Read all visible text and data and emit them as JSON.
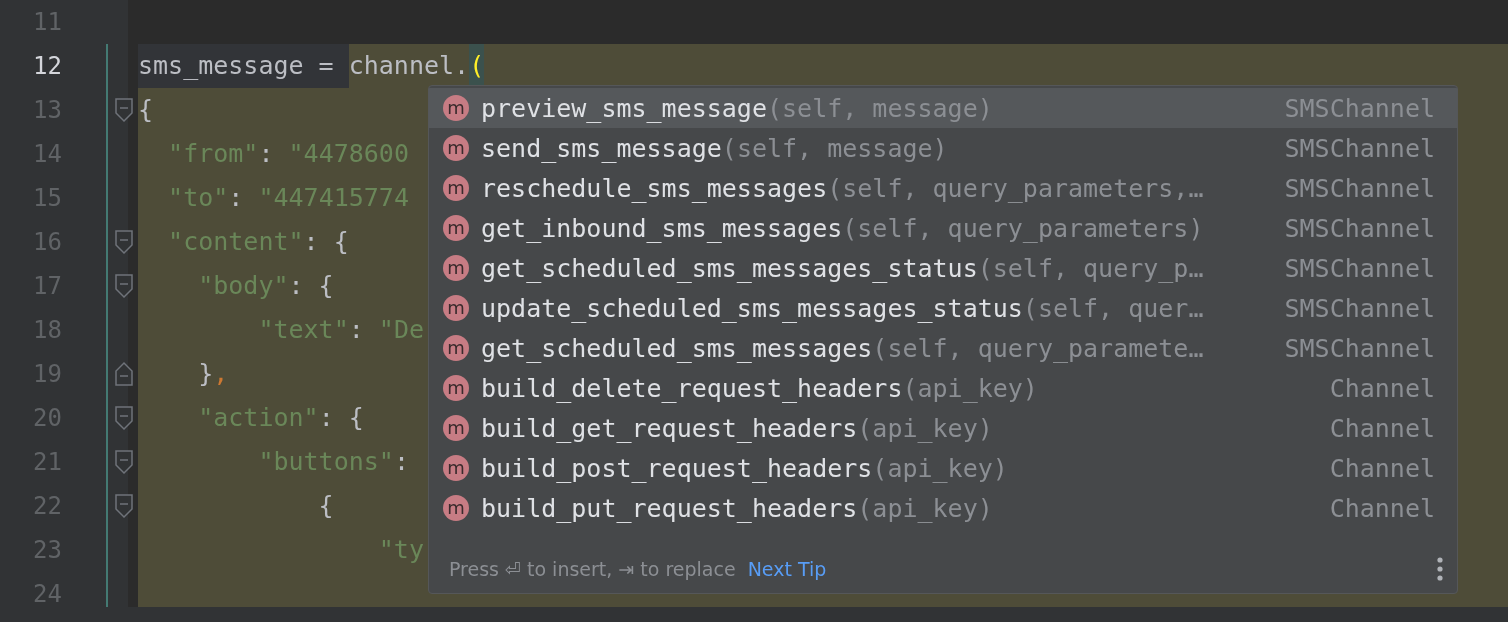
{
  "editor": {
    "lines": [
      {
        "number": "11",
        "current": false,
        "changed": false,
        "injected": false
      },
      {
        "number": "12",
        "current": true,
        "changed": true,
        "injected": false,
        "segments": [
          {
            "kind": "plain",
            "text": "sms_message = ",
            "injected": false
          },
          {
            "kind": "plain",
            "text": "channel.",
            "injected": true
          },
          {
            "kind": "match",
            "text": "(",
            "injected": true
          }
        ]
      },
      {
        "number": "13",
        "current": false,
        "changed": true,
        "injected": true,
        "marker": {
          "kind": "fold-start"
        },
        "segments": [
          {
            "kind": "punct",
            "text": "{"
          }
        ]
      },
      {
        "number": "14",
        "current": false,
        "changed": true,
        "injected": true,
        "segments": [
          {
            "kind": "key",
            "text": "  \"from\""
          },
          {
            "kind": "punct",
            "text": ": "
          },
          {
            "kind": "string",
            "text": "\"4478600"
          }
        ]
      },
      {
        "number": "15",
        "current": false,
        "changed": true,
        "injected": true,
        "segments": [
          {
            "kind": "key",
            "text": "  \"to\""
          },
          {
            "kind": "punct",
            "text": ": "
          },
          {
            "kind": "string",
            "text": "\"447415774"
          }
        ]
      },
      {
        "number": "16",
        "current": false,
        "changed": true,
        "injected": true,
        "marker": {
          "kind": "fold-start"
        },
        "segments": [
          {
            "kind": "key",
            "text": "  \"content\""
          },
          {
            "kind": "punct",
            "text": ": {"
          }
        ]
      },
      {
        "number": "17",
        "current": false,
        "changed": true,
        "injected": true,
        "marker": {
          "kind": "fold-start"
        },
        "segments": [
          {
            "kind": "key",
            "text": "    \"body\""
          },
          {
            "kind": "punct",
            "text": ": {"
          }
        ]
      },
      {
        "number": "18",
        "current": false,
        "changed": true,
        "injected": true,
        "segments": [
          {
            "kind": "key",
            "text": "        \"text\""
          },
          {
            "kind": "punct",
            "text": ": "
          },
          {
            "kind": "string",
            "text": "\"De"
          }
        ]
      },
      {
        "number": "19",
        "current": false,
        "changed": true,
        "injected": true,
        "marker": {
          "kind": "fold-end"
        },
        "segments": [
          {
            "kind": "punct",
            "text": "    }"
          },
          {
            "kind": "comma",
            "text": ","
          }
        ]
      },
      {
        "number": "20",
        "current": false,
        "changed": true,
        "injected": true,
        "marker": {
          "kind": "fold-start"
        },
        "segments": [
          {
            "kind": "key",
            "text": "    \"action\""
          },
          {
            "kind": "punct",
            "text": ": {"
          }
        ]
      },
      {
        "number": "21",
        "current": false,
        "changed": true,
        "injected": true,
        "marker": {
          "kind": "fold-start"
        },
        "segments": [
          {
            "kind": "key",
            "text": "        \"buttons\""
          },
          {
            "kind": "punct",
            "text": ":"
          }
        ]
      },
      {
        "number": "22",
        "current": false,
        "changed": true,
        "injected": true,
        "marker": {
          "kind": "fold-start"
        },
        "segments": [
          {
            "kind": "punct",
            "text": "            {"
          }
        ]
      },
      {
        "number": "23",
        "current": false,
        "changed": true,
        "injected": true,
        "segments": [
          {
            "kind": "key",
            "text": "                \"ty"
          }
        ]
      },
      {
        "number": "24",
        "current": false,
        "changed": true,
        "injected": true
      }
    ]
  },
  "completion": {
    "items": [
      {
        "badge": "m",
        "name": "preview_sms_message",
        "params": "(self, message)",
        "type": "SMSChannel",
        "selected": true
      },
      {
        "badge": "m",
        "name": "send_sms_message",
        "params": "(self, message)",
        "type": "SMSChannel",
        "selected": false
      },
      {
        "badge": "m",
        "name": "reschedule_sms_messages",
        "params": "(self, query_parameters,…",
        "type": "SMSChannel",
        "selected": false
      },
      {
        "badge": "m",
        "name": "get_inbound_sms_messages",
        "params": "(self, query_parameters)",
        "type": "SMSChannel",
        "selected": false
      },
      {
        "badge": "m",
        "name": "get_scheduled_sms_messages_status",
        "params": "(self, query_p…",
        "type": "SMSChannel",
        "selected": false
      },
      {
        "badge": "m",
        "name": "update_scheduled_sms_messages_status",
        "params": "(self, quer…",
        "type": "SMSChannel",
        "selected": false
      },
      {
        "badge": "m",
        "name": "get_scheduled_sms_messages",
        "params": "(self, query_paramete…",
        "type": "SMSChannel",
        "selected": false
      },
      {
        "badge": "m",
        "name": "build_delete_request_headers",
        "params": "(api_key)",
        "type": "Channel",
        "selected": false
      },
      {
        "badge": "m",
        "name": "build_get_request_headers",
        "params": "(api_key)",
        "type": "Channel",
        "selected": false
      },
      {
        "badge": "m",
        "name": "build_post_request_headers",
        "params": "(api_key)",
        "type": "Channel",
        "selected": false
      },
      {
        "badge": "m",
        "name": "build_put_request_headers",
        "params": "(api_key)",
        "type": "Channel",
        "selected": false
      }
    ],
    "footer": {
      "hint": "Press ⏎ to insert, ⇥ to replace",
      "link": "Next Tip"
    }
  }
}
